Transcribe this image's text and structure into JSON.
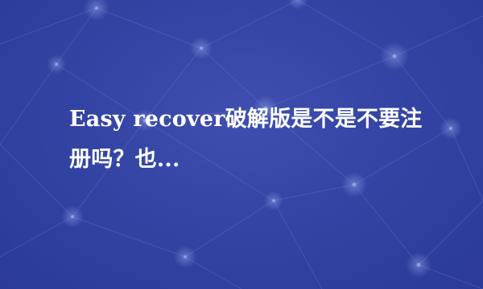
{
  "title": "Easy recover破解版是不是不要注册吗？也...",
  "colors": {
    "background": "#3344a4",
    "network_lines": "#6d7fd0",
    "text": "#ffffff"
  }
}
